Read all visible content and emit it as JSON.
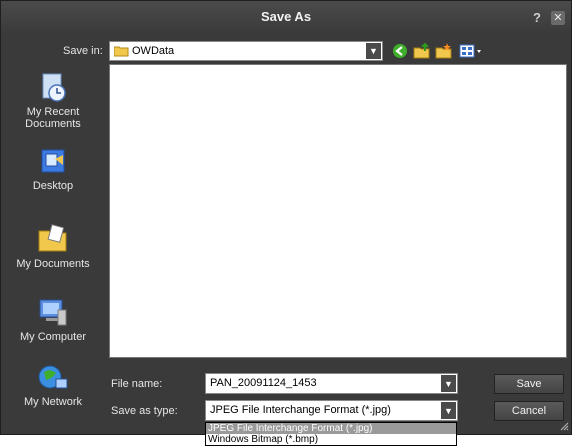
{
  "window": {
    "title": "Save As"
  },
  "save_in": {
    "label": "Save in:",
    "folder": "OWData"
  },
  "places": [
    {
      "label": "My Recent Documents"
    },
    {
      "label": "Desktop"
    },
    {
      "label": "My Documents"
    },
    {
      "label": "My Computer"
    },
    {
      "label": "My Network"
    }
  ],
  "file_name": {
    "label": "File name:",
    "value": "PAN_20091124_1453"
  },
  "save_as_type": {
    "label": "Save as type:",
    "value": "JPEG File Interchange Format (*.jpg)",
    "options": [
      "JPEG File Interchange Format (*.jpg)",
      "Windows Bitmap (*.bmp)"
    ]
  },
  "buttons": {
    "save": "Save",
    "cancel": "Cancel"
  },
  "icons": {
    "help": "?",
    "close": "✕",
    "arrow": "▼"
  },
  "colors": {
    "dialog_bg": "#3a3a3a",
    "selection": "#9a9a9a"
  }
}
